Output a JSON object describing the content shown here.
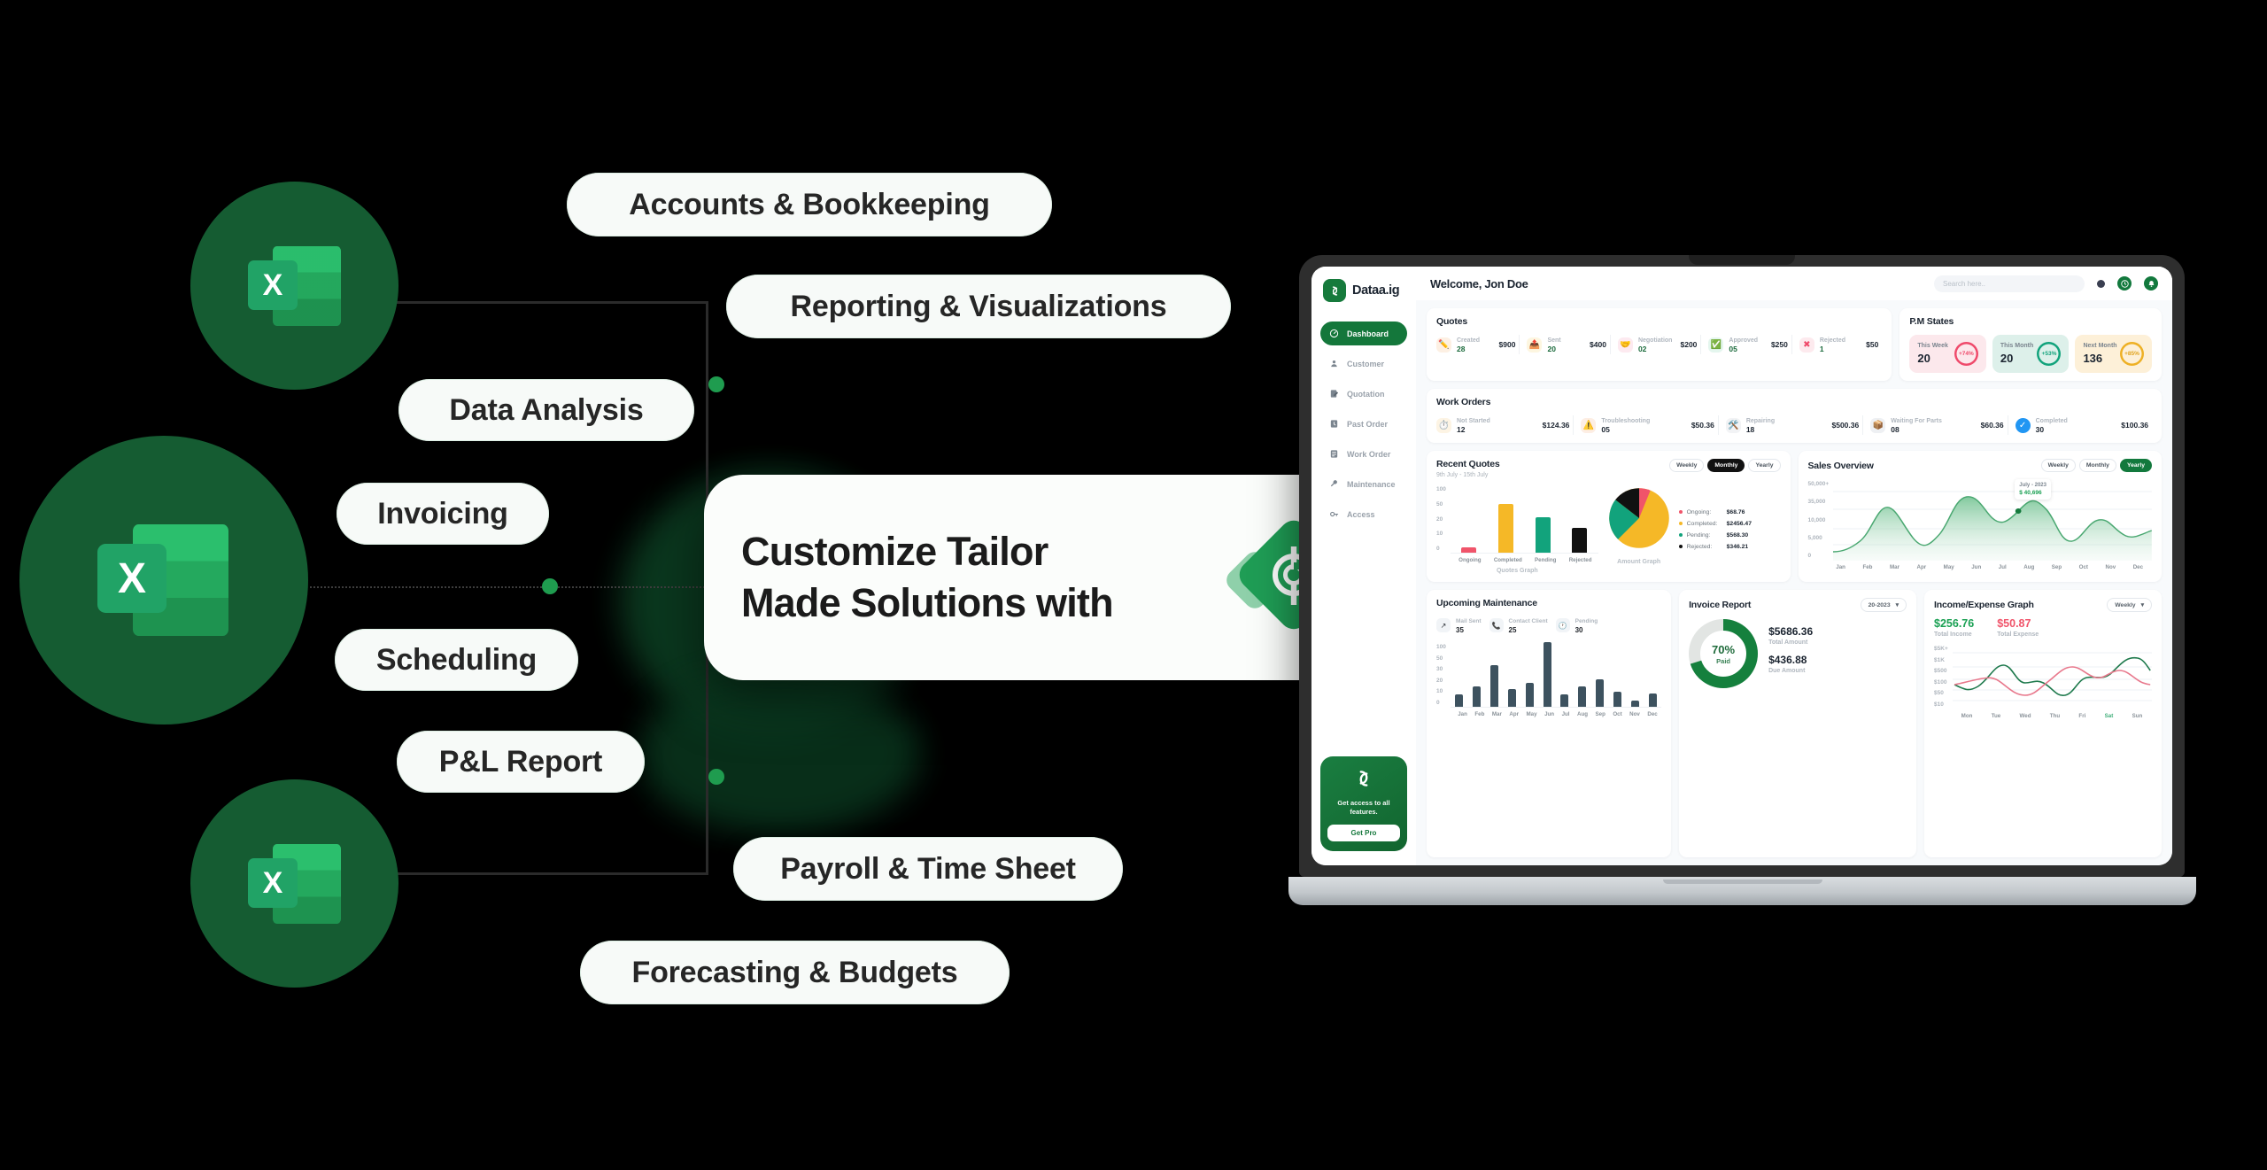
{
  "promo": {
    "line1": "Customize Tailor",
    "line2": "Made Solutions with",
    "logo_alt": "brand-diamond-logo",
    "logo_color": "#1f9d55"
  },
  "feature_pills": [
    {
      "label": "Accounts & Bookkeeping"
    },
    {
      "label": "Reporting & Visualizations"
    },
    {
      "label": "Data Analysis"
    },
    {
      "label": "Invoicing"
    },
    {
      "label": "Scheduling"
    },
    {
      "label": "P&L Report"
    },
    {
      "label": "Payroll & Time Sheet"
    },
    {
      "label": "Forecasting & Budgets"
    }
  ],
  "excel_nodes": [
    {
      "name": "excel-icon-top"
    },
    {
      "name": "excel-icon-middle"
    },
    {
      "name": "excel-icon-bottom"
    }
  ],
  "dashboard": {
    "sidebar": {
      "brand": "Dataa.ig",
      "items": [
        {
          "label": "Dashboard",
          "icon": "gauge-icon",
          "active": true
        },
        {
          "label": "Customer",
          "icon": "user-icon",
          "active": false
        },
        {
          "label": "Quotation",
          "icon": "quote-icon",
          "active": false
        },
        {
          "label": "Past Order",
          "icon": "history-icon",
          "active": false
        },
        {
          "label": "Work Order",
          "icon": "clipboard-icon",
          "active": false
        },
        {
          "label": "Maintenance",
          "icon": "wrench-icon",
          "active": false
        },
        {
          "label": "Access",
          "icon": "key-icon",
          "active": false
        }
      ],
      "promo": {
        "text": "Get access to all features.",
        "button": "Get Pro"
      }
    },
    "topbar": {
      "welcome": "Welcome, Jon Doe",
      "search_placeholder": "Search here..",
      "icons": [
        "clock-icon",
        "bell-icon"
      ]
    },
    "quotes": {
      "title": "Quotes",
      "items": [
        {
          "label": "Created",
          "count": "28",
          "amount": "$900",
          "icon": "pencil-icon"
        },
        {
          "label": "Sent",
          "count": "20",
          "amount": "$400",
          "icon": "send-icon"
        },
        {
          "label": "Negotiation",
          "count": "02",
          "amount": "$200",
          "icon": "handshake-icon"
        },
        {
          "label": "Approved",
          "count": "05",
          "amount": "$250",
          "icon": "check-icon"
        },
        {
          "label": "Rejected",
          "count": "1",
          "amount": "$50",
          "icon": "reject-icon"
        }
      ]
    },
    "pm_states": {
      "title": "P.M States",
      "cards": [
        {
          "label": "This Week",
          "value": "20",
          "delta": "+74%",
          "bg": "#fce8ec",
          "ring": "#ef4a6b"
        },
        {
          "label": "This Month",
          "value": "20",
          "delta": "+53%",
          "bg": "#ddf0ea",
          "ring": "#12a37c"
        },
        {
          "label": "Next Month",
          "value": "136",
          "delta": "+85%",
          "bg": "#fdf0d8",
          "ring": "#eeb024"
        }
      ]
    },
    "work_orders": {
      "title": "Work Orders",
      "items": [
        {
          "label": "Not Started",
          "count": "12",
          "amount": "$124.36",
          "icon": "timer-icon"
        },
        {
          "label": "Troubleshooting",
          "count": "05",
          "amount": "$50.36",
          "icon": "alert-icon"
        },
        {
          "label": "Repairing",
          "count": "18",
          "amount": "$500.36",
          "icon": "tools-icon"
        },
        {
          "label": "Waiting For Parts",
          "count": "08",
          "amount": "$60.36",
          "icon": "box-icon"
        },
        {
          "label": "Completed",
          "count": "30",
          "amount": "$100.36",
          "icon": "check-circle-icon"
        }
      ]
    },
    "recent_quotes": {
      "title": "Recent Quotes",
      "subtitle": "9th July - 15th July",
      "segments": [
        "Weekly",
        "Monthly",
        "Yearly"
      ],
      "active_segment": "Monthly",
      "bar_caption": "Quotes Graph",
      "pie_caption": "Amount Graph",
      "legend": [
        {
          "name": "Ongoing:",
          "amount": "$68.76",
          "color": "#f0546a"
        },
        {
          "name": "Completed:",
          "amount": "$2456.47",
          "color": "#f5b827"
        },
        {
          "name": "Pending:",
          "amount": "$568.30",
          "color": "#12a37c"
        },
        {
          "name": "Rejected:",
          "amount": "$346.21",
          "color": "#111111"
        }
      ]
    },
    "sales_overview": {
      "title": "Sales Overview",
      "segments": [
        "Weekly",
        "Monthly",
        "Yearly"
      ],
      "active_segment": "Yearly",
      "tooltip_label": "July - 2023",
      "tooltip_value": "$ 40,696"
    },
    "upcoming_maintenance": {
      "title": "Upcoming Maintenance",
      "stats": [
        {
          "label": "Mail Sent",
          "value": "35",
          "icon": "mail-icon"
        },
        {
          "label": "Contact Client",
          "value": "25",
          "icon": "phone-icon"
        },
        {
          "label": "Pending",
          "value": "30",
          "icon": "clock-icon"
        }
      ]
    },
    "invoice_report": {
      "title": "Invoice Report",
      "period": "20-2023",
      "percent": "70%",
      "percent_label": "Paid",
      "total_amount": "$5686.36",
      "total_label": "Total Amount",
      "due_amount": "$436.88",
      "due_label": "Due Amount"
    },
    "income_expense": {
      "title": "Income/Expense Graph",
      "period": "Weekly",
      "income": "$256.76",
      "income_label": "Total Income",
      "expense": "$50.87",
      "expense_label": "Total Expense"
    }
  },
  "chart_data": [
    {
      "type": "bar",
      "title": "Quotes Graph",
      "categories": [
        "Ongoing",
        "Completed",
        "Pending",
        "Rejected"
      ],
      "values": [
        5,
        57,
        36,
        25
      ],
      "colors": [
        "#f0546a",
        "#f5b827",
        "#12a37c",
        "#111111"
      ],
      "ylabel": "",
      "xlabel": "",
      "yticks": [
        "100",
        "50",
        "20",
        "10",
        "0"
      ],
      "ylim": [
        0,
        100
      ],
      "grid": true
    },
    {
      "type": "pie",
      "title": "Amount Graph",
      "labels": [
        "Ongoing",
        "Completed",
        "Pending",
        "Rejected"
      ],
      "values": [
        68.76,
        2456.47,
        568.3,
        346.21
      ],
      "colors": [
        "#f0546a",
        "#f5b827",
        "#12a37c",
        "#111111"
      ],
      "legend": "right"
    },
    {
      "type": "area",
      "title": "Sales Overview",
      "x": [
        "Jan",
        "Feb",
        "Mar",
        "Apr",
        "May",
        "Jun",
        "Jul",
        "Aug",
        "Sep",
        "Oct",
        "Nov",
        "Dec"
      ],
      "values": [
        4000,
        9000,
        36000,
        7000,
        43000,
        25000,
        40696,
        9000,
        22000,
        11000,
        24000,
        13000
      ],
      "yticks": [
        "50,000+",
        "35,000",
        "10,000",
        "5,000",
        "0"
      ],
      "ylim": [
        0,
        50000
      ],
      "color": "#2f9e63",
      "annotation": {
        "label": "July - 2023",
        "value": "$ 40,696",
        "x": "Jul"
      },
      "grid": true
    },
    {
      "type": "bar",
      "title": "Upcoming Maintenance",
      "categories": [
        "Jan",
        "Feb",
        "Mar",
        "Apr",
        "May",
        "Jun",
        "Jul",
        "Aug",
        "Sep",
        "Oct",
        "Nov",
        "Dec"
      ],
      "values": [
        15,
        25,
        50,
        22,
        29,
        78,
        15,
        24,
        33,
        18,
        7,
        17
      ],
      "color": "#3d525f",
      "yticks": [
        "100",
        "50",
        "30",
        "20",
        "10",
        "0"
      ],
      "ylim": [
        0,
        100
      ],
      "grid": true
    },
    {
      "type": "pie",
      "title": "Invoice Report",
      "labels": [
        "Paid",
        "Unpaid"
      ],
      "values": [
        70,
        30
      ],
      "colors": [
        "#15803d",
        "#e2e5e3"
      ],
      "center_label": "70%",
      "center_sub": "Paid"
    },
    {
      "type": "line",
      "title": "Income/Expense Graph",
      "x": [
        "Mon",
        "Tue",
        "Wed",
        "Thu",
        "Fri",
        "Sat",
        "Sun"
      ],
      "series": [
        {
          "name": "Income",
          "values": [
            100,
            500,
            130,
            50,
            450,
            200,
            1000
          ],
          "color": "#1f7a4d"
        },
        {
          "name": "Expense",
          "values": [
            100,
            150,
            50,
            500,
            200,
            500,
            90
          ],
          "color": "#e8788c"
        }
      ],
      "yticks": [
        "$5K+",
        "$1K",
        "$500",
        "$100",
        "$50",
        "$10"
      ],
      "grid": true
    }
  ]
}
